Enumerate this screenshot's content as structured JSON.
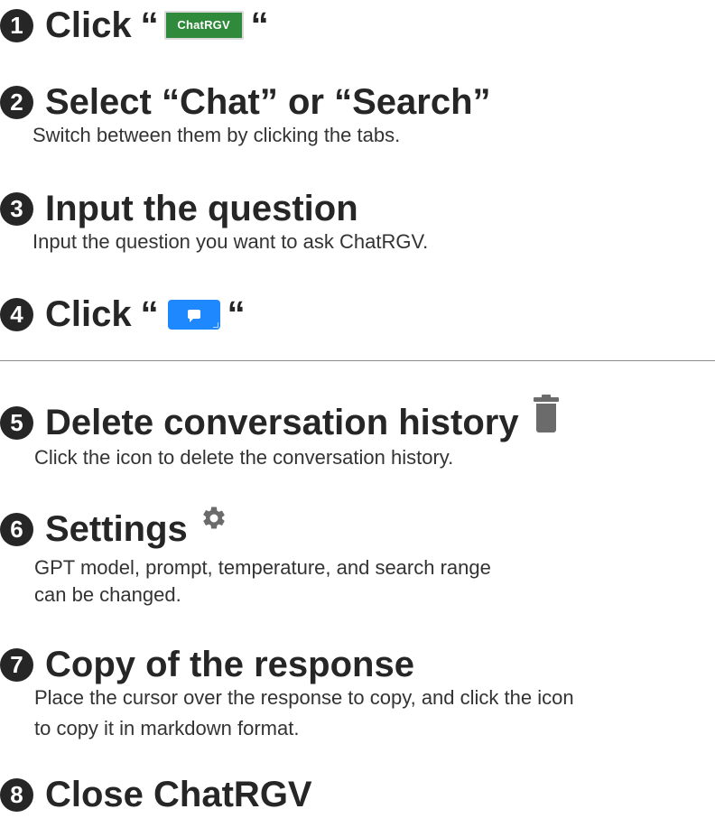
{
  "steps": [
    {
      "num": "1",
      "title": "Click",
      "open_quote": "“",
      "close_quote": "“",
      "button_label": "ChatRGV"
    },
    {
      "num": "2",
      "title": "Select “Chat” or “Search”",
      "desc": "Switch between them by clicking the tabs."
    },
    {
      "num": "3",
      "title": "Input the question",
      "desc": "Input the question you want to ask ChatRGV."
    },
    {
      "num": "4",
      "title": "Click",
      "open_quote": "“",
      "close_quote": "“",
      "icon": "chat-send-icon"
    },
    {
      "num": "5",
      "title": "Delete conversation history",
      "desc": "Click the icon to delete the conversation history.",
      "icon": "trash-icon"
    },
    {
      "num": "6",
      "title": "Settings",
      "desc_lines": [
        "GPT model, prompt, temperature, and search range",
        "can be changed."
      ],
      "icon": "gear-icon"
    },
    {
      "num": "7",
      "title": "Copy of the response",
      "desc_lines": [
        "Place the cursor over the response to copy, and click the icon",
        "to copy it in markdown format."
      ]
    },
    {
      "num": "8",
      "title": "Close ChatRGV"
    }
  ],
  "colors": {
    "chatrgv_button": "#2f8a3b",
    "send_button": "#1e88ff",
    "icon_gray": "#6b6b6b",
    "text": "#262626"
  }
}
